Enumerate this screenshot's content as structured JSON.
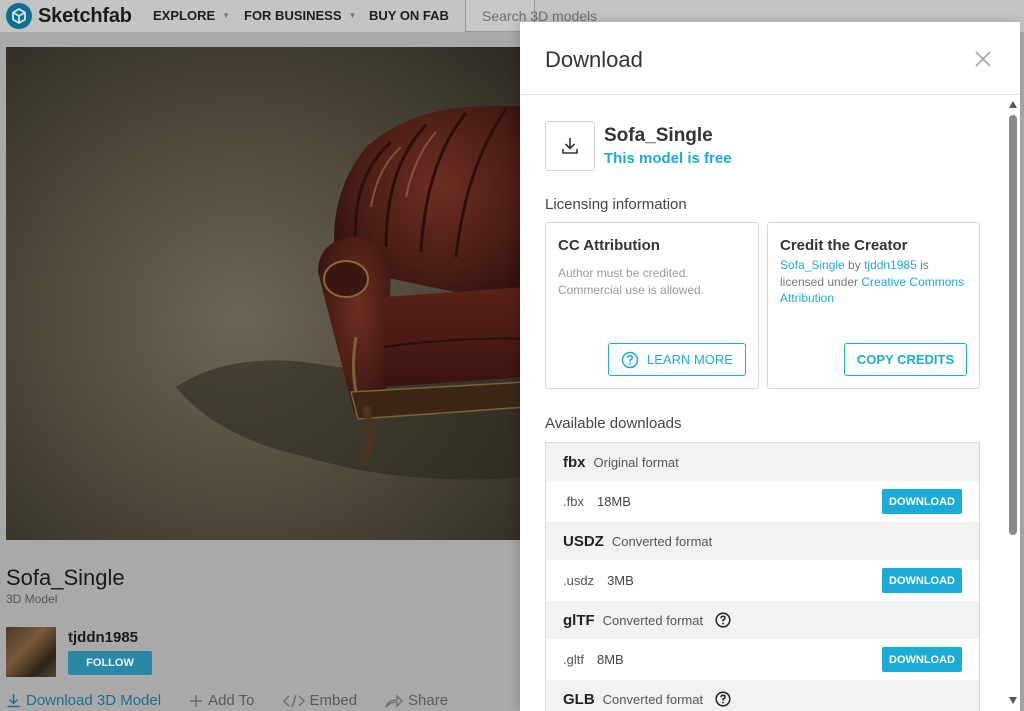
{
  "topbar": {
    "logo_text": "Sketchfab",
    "nav": [
      {
        "label": "EXPLORE",
        "has_caret": true
      },
      {
        "label": "FOR BUSINESS",
        "has_caret": true
      },
      {
        "label": "BUY ON FAB",
        "has_caret": false
      }
    ],
    "search_placeholder": "Search 3D models"
  },
  "model": {
    "title": "Sofa_Single",
    "subtitle": "3D Model",
    "author": "tjddn1985",
    "follow_label": "FOLLOW"
  },
  "actions": {
    "download": "Download 3D Model",
    "add_to": "Add To",
    "embed": "Embed",
    "share": "Share"
  },
  "modal": {
    "title": "Download",
    "model_name": "Sofa_Single",
    "free_text": "This model is free",
    "licensing_title": "Licensing information",
    "license_card": {
      "title": "CC Attribution",
      "line1": "Author must be credited.",
      "line2": "Commercial use is allowed.",
      "button": "LEARN MORE"
    },
    "credit_card": {
      "title": "Credit the Creator",
      "model_link": "Sofa_Single",
      "by": " by ",
      "author_link": "tjddn1985",
      "is_licensed": " is licensed under ",
      "license_link": "Creative Commons Attribution",
      "button": "COPY CREDITS"
    },
    "downloads_title": "Available downloads",
    "download_label": "DOWNLOAD",
    "formats": [
      {
        "name": "fbx",
        "desc": "Original format",
        "ext": ".fbx",
        "size": "18MB",
        "help": false
      },
      {
        "name": "USDZ",
        "desc": "Converted format",
        "ext": ".usdz",
        "size": "3MB",
        "help": false
      },
      {
        "name": "glTF",
        "desc": "Converted format",
        "ext": ".gltf",
        "size": "8MB",
        "help": true
      },
      {
        "name": "GLB",
        "desc": "Converted format",
        "help": true
      }
    ]
  },
  "colors": {
    "accent": "#1caad9",
    "brand_dark": "#0d6e8f"
  }
}
